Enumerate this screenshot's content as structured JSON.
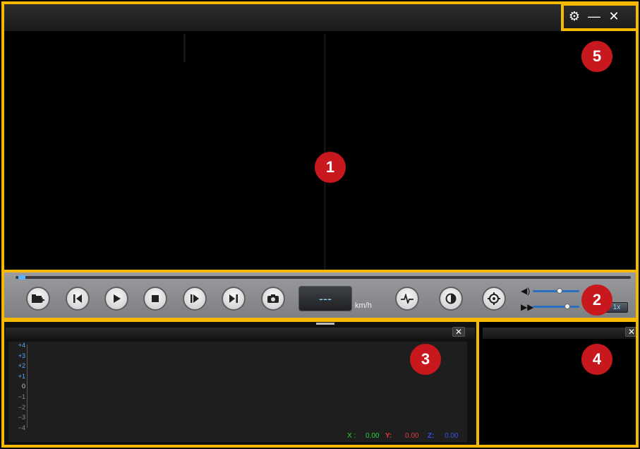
{
  "title_bar": {
    "controls": {
      "settings": "⚙",
      "minimize": "—",
      "close": "✕"
    }
  },
  "callouts": [
    "1",
    "2",
    "3",
    "4",
    "5"
  ],
  "controls": {
    "speed_value": "---",
    "speed_unit": "km/h",
    "rate": "1x"
  },
  "gsensor": {
    "y_ticks": [
      "+4",
      "+3",
      "+2",
      "+1",
      "0",
      "−1",
      "−2",
      "−3",
      "−4"
    ],
    "readouts": {
      "x_label": "X :",
      "x_value": "0.00",
      "y_label": "Y:",
      "y_value": "0.00",
      "z_label": "Z:",
      "z_value": "0.00"
    }
  },
  "panel_close": "✕",
  "colors": {
    "highlight": "#f6b800",
    "badge": "#c8171d",
    "x": "#25d53b",
    "y": "#e23b3b",
    "z": "#3b4fe2",
    "tick_pos": "#58a8ff",
    "tick_neg": "#8a8a8a"
  }
}
